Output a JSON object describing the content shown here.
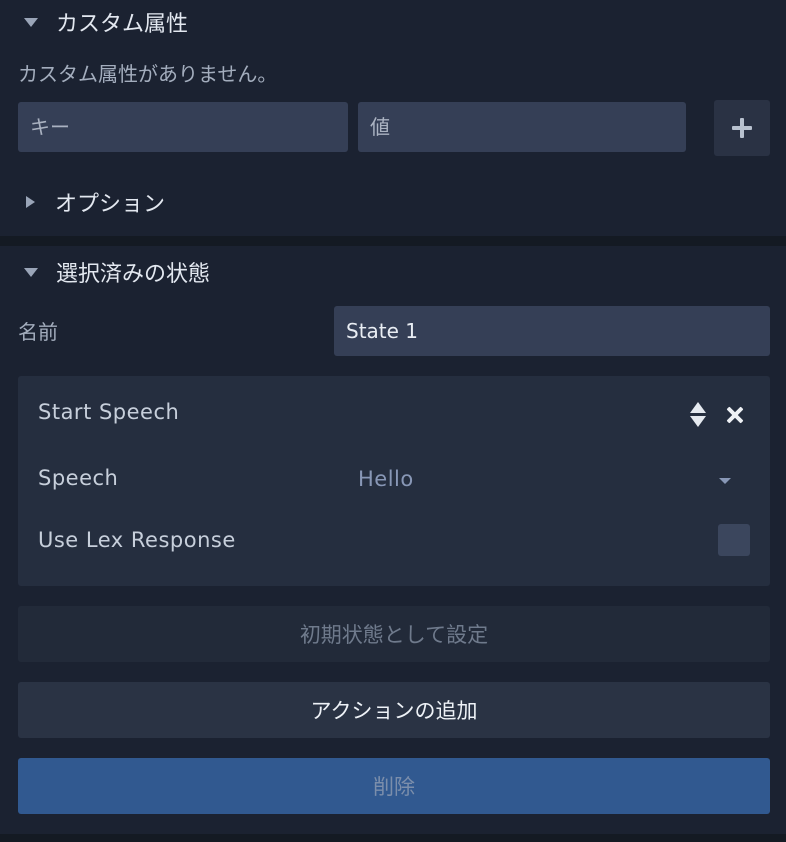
{
  "custom_attributes": {
    "header": "カスタム属性",
    "empty_message": "カスタム属性がありません。",
    "key_placeholder": "キー",
    "value_placeholder": "値"
  },
  "options": {
    "header": "オプション"
  },
  "selected_state": {
    "header": "選択済みの状態",
    "name_label": "名前",
    "name_value": "State 1",
    "action": {
      "title": "Start Speech",
      "speech_label": "Speech",
      "speech_value": "Hello",
      "use_lex_label": "Use Lex Response",
      "use_lex_checked": false
    },
    "set_initial_label": "初期状態として設定",
    "add_action_label": "アクションの追加",
    "delete_label": "削除"
  },
  "colors": {
    "background": "#141a23",
    "panel": "#1b2231",
    "input": "#353f56",
    "delete_button": "#315990"
  }
}
